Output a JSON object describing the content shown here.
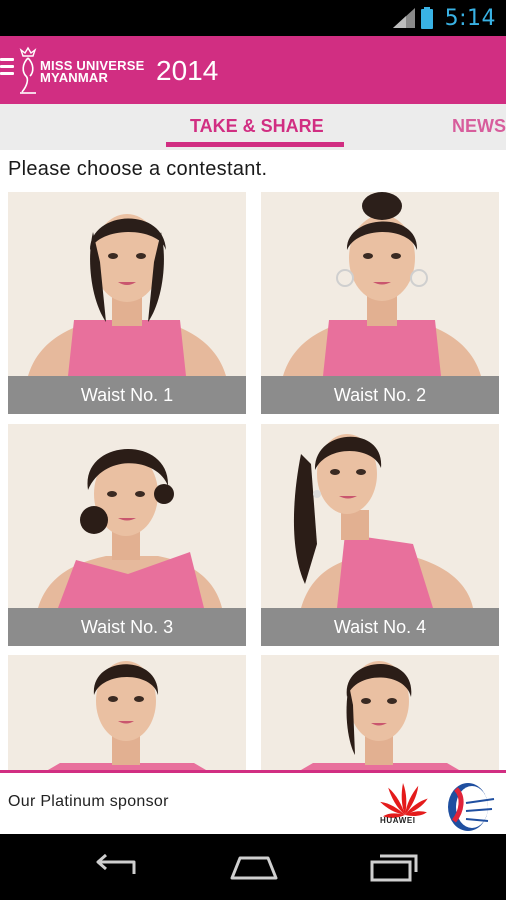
{
  "status_bar": {
    "time": "5:14",
    "icons": [
      "signal-icon",
      "battery-icon"
    ],
    "time_color": "#39b2e4"
  },
  "header": {
    "brand_line1": "MISS UNIVERSE",
    "brand_line2": "MYANMAR",
    "year": "2014",
    "background": "#d12e82",
    "icons": [
      "menu-icon",
      "crown-logo"
    ]
  },
  "tabs": [
    {
      "label": "TAKE & SHARE",
      "active": true
    },
    {
      "label": "NEWS",
      "active": false
    }
  ],
  "prompt": "Please choose a contestant.",
  "contestants": [
    {
      "label": "Waist No. 1"
    },
    {
      "label": "Waist No. 2"
    },
    {
      "label": "Waist No. 3"
    },
    {
      "label": "Waist No. 4"
    },
    {
      "label": ""
    },
    {
      "label": ""
    }
  ],
  "sponsor": {
    "label": "Our Platinum sponsor",
    "huawei_wordmark": "HUAWEI",
    "logos": [
      "huawei-logo",
      "bangkok-airways-logo"
    ]
  },
  "nav_bar": {
    "icons": [
      "back-icon",
      "home-icon",
      "recent-apps-icon"
    ]
  }
}
